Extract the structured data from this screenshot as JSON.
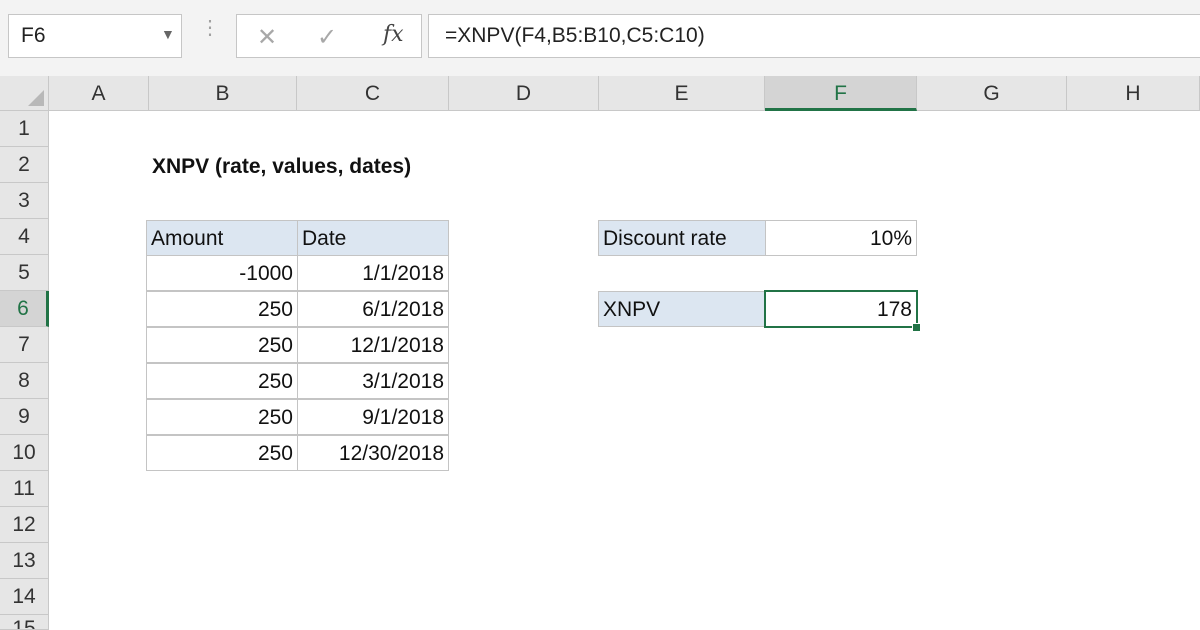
{
  "formula_bar": {
    "name_box": "F6",
    "fx_label": "fx",
    "formula": "=XNPV(F4,B5:B10,C5:C10)"
  },
  "columns": [
    "A",
    "B",
    "C",
    "D",
    "E",
    "F",
    "G",
    "H"
  ],
  "active_column": "F",
  "rows": [
    "1",
    "2",
    "3",
    "4",
    "5",
    "6",
    "7",
    "8",
    "9",
    "10",
    "11",
    "12",
    "13",
    "14",
    "15"
  ],
  "active_row": "6",
  "sheet": {
    "title": "XNPV (rate, values, dates)",
    "table": {
      "headers": [
        "Amount",
        "Date"
      ],
      "rows": [
        {
          "amount": "-1000",
          "date": "1/1/2018"
        },
        {
          "amount": "250",
          "date": "6/1/2018"
        },
        {
          "amount": "250",
          "date": "12/1/2018"
        },
        {
          "amount": "250",
          "date": "3/1/2018"
        },
        {
          "amount": "250",
          "date": "9/1/2018"
        },
        {
          "amount": "250",
          "date": "12/30/2018"
        }
      ]
    },
    "discount_rate_label": "Discount rate",
    "discount_rate_value": "10%",
    "xnpv_label": "XNPV",
    "xnpv_value": "178"
  },
  "colors": {
    "accent": "#217346",
    "header_fill": "#dce6f1"
  }
}
